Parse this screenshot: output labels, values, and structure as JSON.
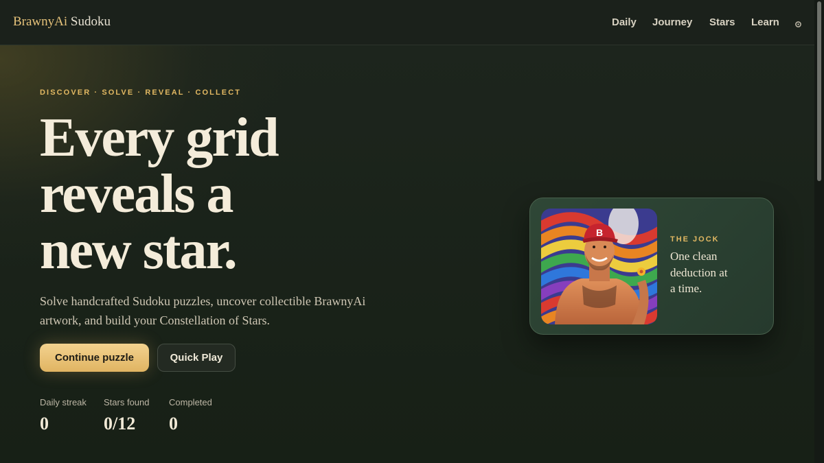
{
  "header": {
    "brand_primary": "BrawnyAi",
    "brand_secondary": "Sudoku",
    "nav": [
      {
        "label": "Daily"
      },
      {
        "label": "Journey"
      },
      {
        "label": "Stars"
      },
      {
        "label": "Learn"
      }
    ],
    "settings_icon": "gear-icon"
  },
  "hero": {
    "eyebrow": "DISCOVER · SOLVE · REVEAL · COLLECT",
    "headline_lines": [
      "Every grid",
      "reveals a",
      "new star."
    ],
    "lede": "Solve handcrafted Sudoku puzzles, uncover collectible BrawnyAi artwork, and build your Constellation of Stars.",
    "primary_button": "Continue puzzle",
    "secondary_button": "Quick Play"
  },
  "stats": [
    {
      "label": "Daily streak",
      "value": "0"
    },
    {
      "label": "Stars found",
      "value": "0/12"
    },
    {
      "label": "Completed",
      "value": "0"
    }
  ],
  "card": {
    "tag": "THE JOCK",
    "quote": "One clean deduction at a time.",
    "image": "muscular-man-red-cap-rainbow-artwork",
    "cap_letter": "B"
  },
  "colors": {
    "background": "#1a2119",
    "accent_gold": "#e2b862",
    "card_bg": "#2f4736",
    "text_cream": "#f4ecda"
  }
}
